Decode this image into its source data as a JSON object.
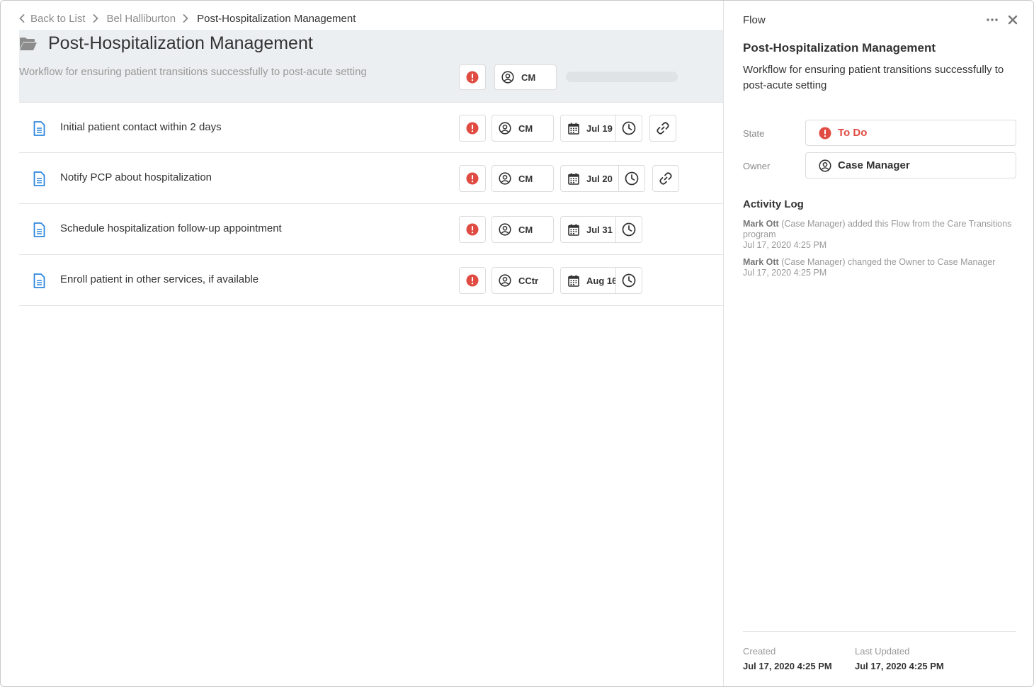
{
  "breadcrumb": {
    "back_label": "Back to List",
    "patient": "Bel Halliburton",
    "current": "Post-Hospitalization Management"
  },
  "flow": {
    "title": "Post-Hospitalization Management",
    "description": "Workflow for ensuring patient transitions successfully to post-acute setting",
    "owner_initials": "CM",
    "progress_fraction": 0
  },
  "tasks": [
    {
      "label": "Initial patient contact within 2 days",
      "owner": "CM",
      "due": "Jul 19",
      "has_link": true
    },
    {
      "label": "Notify PCP about hospitalization",
      "owner": "CM",
      "due": "Jul 20",
      "has_link": true
    },
    {
      "label": "Schedule hospitalization follow-up appointment",
      "owner": "CM",
      "due": "Jul 31",
      "has_link": false
    },
    {
      "label": "Enroll patient in other services, if available",
      "owner": "CCtr",
      "due": "Aug 16",
      "has_link": false
    }
  ],
  "panel": {
    "header": "Flow",
    "title": "Post-Hospitalization Management",
    "description": "Workflow for ensuring patient transitions successfully to post-acute setting",
    "state_label": "State",
    "state_value": "To Do",
    "owner_label": "Owner",
    "owner_value": "Case Manager",
    "activity_title": "Activity Log",
    "activity": [
      {
        "actor": "Mark Ott",
        "text": "(Case Manager) added this Flow from the Care Transitions program",
        "time": "Jul 17, 2020 4:25 PM"
      },
      {
        "actor": "Mark Ott",
        "text": "(Case Manager) changed the Owner to Case Manager",
        "time": "Jul 17, 2020 4:25 PM"
      }
    ],
    "created_label": "Created",
    "created_value": "Jul 17, 2020 4:25 PM",
    "updated_label": "Last Updated",
    "updated_value": "Jul 17, 2020 4:25 PM"
  },
  "colors": {
    "alert": "#e04b42",
    "doc_icon": "#2e86de",
    "header_band": "#eceff1",
    "state_text": "#e04b42"
  },
  "icons": {
    "breadcrumb_back": "chevron-left-icon",
    "breadcrumb_sep": "chevron-right-icon",
    "flow": "folder-icon",
    "task": "document-icon",
    "alert": "alert-icon",
    "owner": "user-circle-icon",
    "date": "calendar-icon",
    "clock": "clock-icon",
    "link": "link-icon",
    "more": "more-icon",
    "close": "close-icon"
  }
}
